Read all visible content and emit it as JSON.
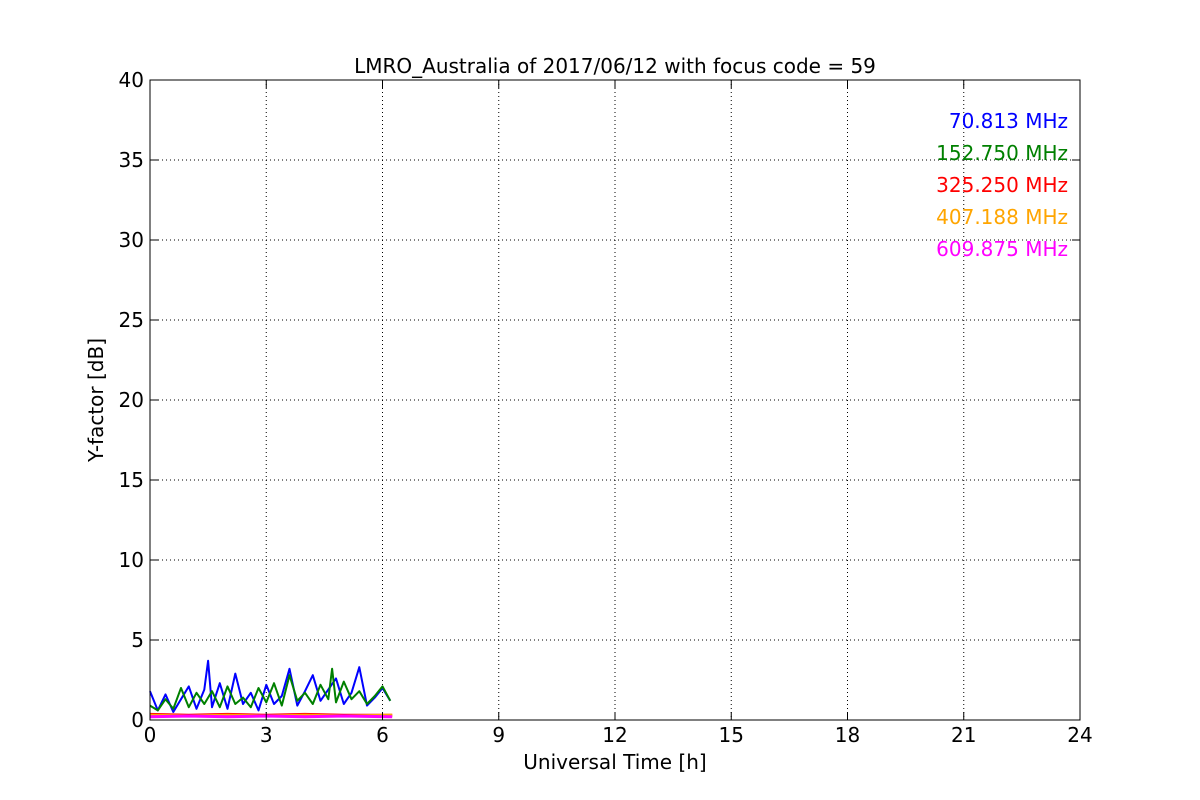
{
  "chart_data": {
    "type": "line",
    "title": "LMRO_Australia of 2017/06/12 with focus code = 59",
    "xlabel": "Universal Time [h]",
    "ylabel": "Y-factor [dB]",
    "xlim": [
      0,
      24
    ],
    "ylim": [
      0,
      40
    ],
    "xticks": [
      0,
      3,
      6,
      9,
      12,
      15,
      18,
      21,
      24
    ],
    "yticks": [
      0,
      5,
      10,
      15,
      20,
      25,
      30,
      35,
      40
    ],
    "xtick_labels": [
      "0",
      "3",
      "6",
      "9",
      "12",
      "15",
      "18",
      "21",
      "24"
    ],
    "ytick_labels": [
      "0",
      "5",
      "10",
      "15",
      "20",
      "25",
      "30",
      "35",
      "40"
    ],
    "grid": true,
    "legend_position": "top-right",
    "series": [
      {
        "name": "70.813 MHz",
        "color": "#0000ff",
        "x": [
          0.0,
          0.2,
          0.4,
          0.6,
          0.8,
          1.0,
          1.2,
          1.4,
          1.5,
          1.6,
          1.8,
          2.0,
          2.2,
          2.4,
          2.6,
          2.8,
          3.0,
          3.2,
          3.4,
          3.6,
          3.8,
          4.0,
          4.2,
          4.4,
          4.6,
          4.8,
          5.0,
          5.2,
          5.4,
          5.6,
          5.8,
          6.0,
          6.2
        ],
        "values": [
          1.8,
          0.6,
          1.6,
          0.5,
          1.3,
          2.1,
          0.7,
          1.9,
          3.7,
          0.8,
          2.3,
          0.7,
          2.9,
          1.0,
          1.7,
          0.6,
          2.2,
          1.0,
          1.5,
          3.2,
          0.9,
          1.8,
          2.8,
          1.2,
          1.9,
          2.6,
          1.0,
          1.7,
          3.3,
          0.9,
          1.4,
          2.0,
          1.2
        ]
      },
      {
        "name": "152.750 MHz",
        "color": "#008000",
        "x": [
          0.0,
          0.2,
          0.4,
          0.6,
          0.8,
          1.0,
          1.2,
          1.4,
          1.6,
          1.8,
          2.0,
          2.2,
          2.4,
          2.6,
          2.8,
          3.0,
          3.2,
          3.4,
          3.6,
          3.8,
          4.0,
          4.2,
          4.4,
          4.6,
          4.7,
          4.8,
          5.0,
          5.2,
          5.4,
          5.6,
          5.8,
          6.0,
          6.2
        ],
        "values": [
          0.9,
          0.6,
          1.3,
          0.7,
          2.0,
          0.8,
          1.7,
          1.0,
          1.8,
          0.8,
          2.1,
          1.0,
          1.4,
          0.8,
          2.0,
          1.1,
          2.3,
          0.9,
          2.8,
          1.2,
          1.7,
          1.0,
          2.2,
          1.3,
          3.2,
          1.1,
          2.4,
          1.3,
          1.8,
          1.0,
          1.5,
          2.1,
          1.2
        ]
      },
      {
        "name": "325.250 MHz",
        "color": "#ff0000",
        "x": [
          0.0,
          1.0,
          2.0,
          3.0,
          4.0,
          5.0,
          6.25
        ],
        "values": [
          0.35,
          0.3,
          0.35,
          0.3,
          0.35,
          0.3,
          0.3
        ]
      },
      {
        "name": "407.188 MHz",
        "color": "#ffa500",
        "x": [
          0.0,
          1.0,
          2.0,
          3.0,
          4.0,
          5.0,
          6.25
        ],
        "values": [
          0.3,
          0.25,
          0.3,
          0.25,
          0.3,
          0.25,
          0.3
        ]
      },
      {
        "name": "609.875 MHz",
        "color": "#ff00ff",
        "x": [
          0.0,
          1.0,
          2.0,
          3.0,
          4.0,
          5.0,
          6.25
        ],
        "values": [
          0.2,
          0.25,
          0.2,
          0.25,
          0.2,
          0.25,
          0.2
        ]
      }
    ]
  }
}
